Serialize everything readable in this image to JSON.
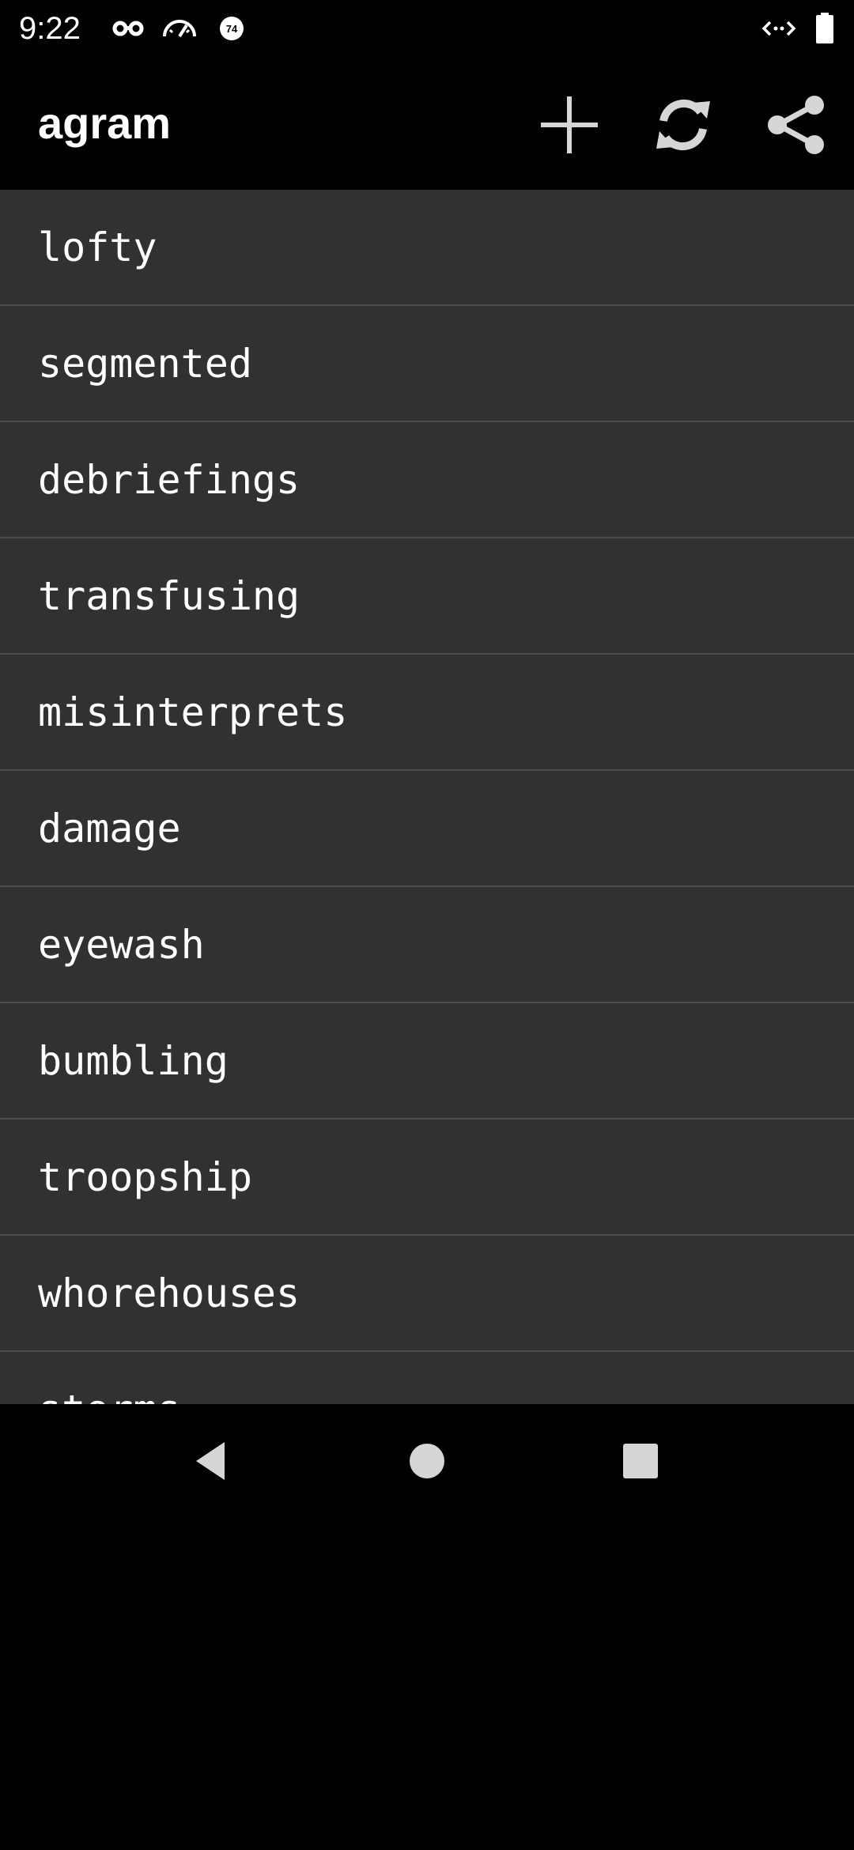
{
  "status_bar": {
    "time": "9:22",
    "notification_icons": [
      "incognito-icon",
      "speedometer-icon",
      "circle-74-icon"
    ],
    "badge_number": "74",
    "right_icons": [
      "data-arrows-icon",
      "battery-icon"
    ]
  },
  "app_bar": {
    "title": "agram",
    "actions": [
      {
        "name": "add",
        "icon": "plus-icon"
      },
      {
        "name": "refresh",
        "icon": "refresh-icon"
      },
      {
        "name": "share",
        "icon": "share-icon"
      }
    ]
  },
  "words": [
    "lofty",
    "segmented",
    "debriefings",
    "transfusing",
    "misinterprets",
    "damage",
    "eyewash",
    "bumbling",
    "troopship",
    "whorehouses",
    "storms"
  ],
  "navigation": {
    "buttons": [
      "back-icon",
      "home-icon",
      "recents-icon"
    ]
  },
  "colors": {
    "background": "#000000",
    "list_background": "#313131",
    "divider": "#4d4d4d",
    "text": "#ffffff",
    "icon": "#d6d6d6"
  }
}
